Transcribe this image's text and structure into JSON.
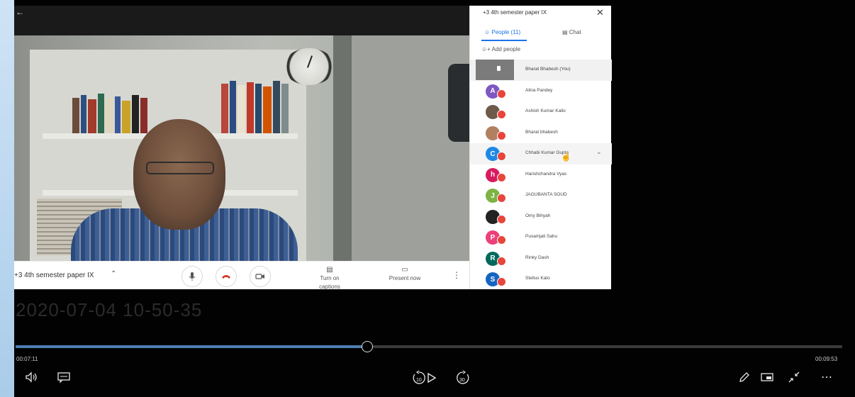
{
  "meeting": {
    "name": "+3 4th semester paper IX",
    "panel_title": "+3 4th semester paper IX",
    "tab_people": "People (11)",
    "tab_chat": "Chat",
    "add_people": "Add people",
    "captions_label": "Turn on captions",
    "present_label": "Present now",
    "participants": [
      {
        "name": "Bharat Bhabesh (You)",
        "initial": "",
        "color": "#7b7b7b"
      },
      {
        "name": "Alina Pandey",
        "initial": "A",
        "color": "#7e57c2"
      },
      {
        "name": "Ashish Kumar Kallo",
        "initial": "",
        "color": "#6d5a4a"
      },
      {
        "name": "Bharat bhabesh",
        "initial": "",
        "color": "#b08060"
      },
      {
        "name": "Chhabi Kumar Gupta",
        "initial": "C",
        "color": "#1e88e5"
      },
      {
        "name": "Harishchandra Vyas",
        "initial": "h",
        "color": "#d81b60"
      },
      {
        "name": "JAGUBANTA SOUD",
        "initial": "J",
        "color": "#7cb342"
      },
      {
        "name": "Omy Bihyah",
        "initial": "",
        "color": "#222222"
      },
      {
        "name": "Pusamjali Sahu",
        "initial": "P",
        "color": "#ec407a"
      },
      {
        "name": "Rinky Dash",
        "initial": "R",
        "color": "#00695c"
      },
      {
        "name": "Stellus Kato",
        "initial": "S",
        "color": "#1565c0"
      }
    ]
  },
  "recording": {
    "timestamp": "2020-07-04 10-50-35"
  },
  "player": {
    "elapsed": "00:07:11",
    "duration": "00:09:53",
    "progress": 0.425,
    "skip_back": "10",
    "skip_forward": "30",
    "accent": "#4d7db1"
  }
}
